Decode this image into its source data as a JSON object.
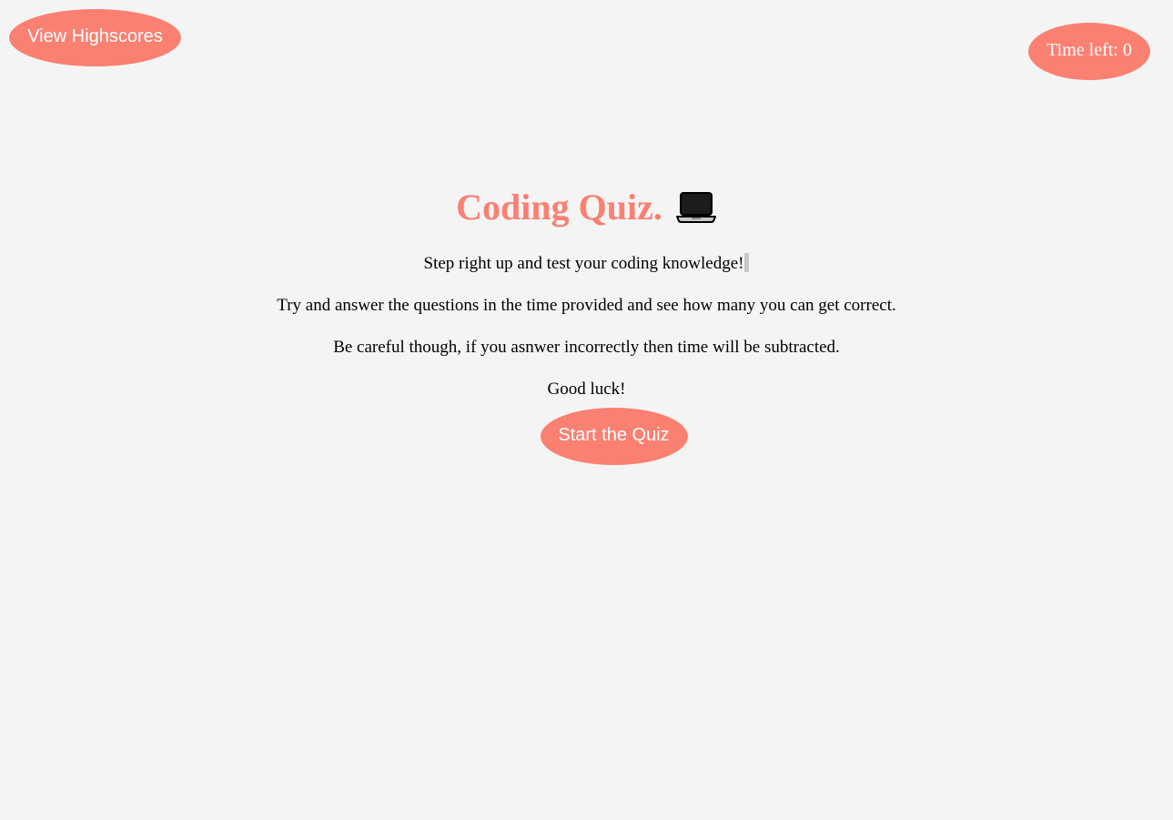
{
  "header": {
    "highscores_label": "View Highscores",
    "timer_text": "Time left: 0"
  },
  "main": {
    "title": "Coding Quiz.",
    "title_icon": "laptop-icon",
    "paragraphs": [
      "Step right up and test your coding knowledge!",
      "Try and answer the questions in the time provided and see how many you can get correct.",
      "Be careful though, if you asnwer incorrectly then time will be subtracted.",
      "Good luck!"
    ],
    "start_label": "Start the Quiz"
  },
  "colors": {
    "accent": "#fa8072",
    "background": "#f4f4f4",
    "text": "#000000",
    "button_text": "#ffffff"
  }
}
